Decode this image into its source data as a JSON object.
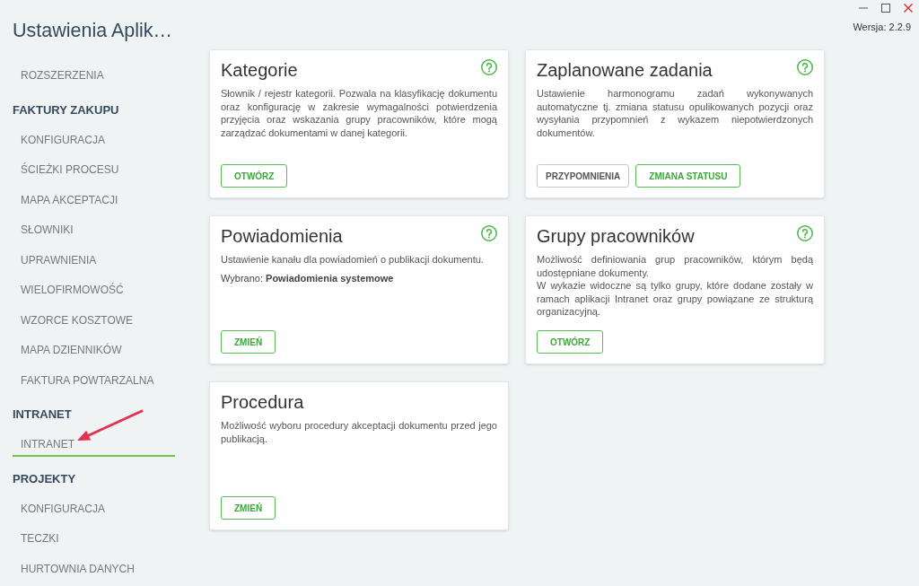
{
  "window": {
    "title": "Ustawienia Aplik…",
    "version": "Wersja: 2.2.9"
  },
  "sidebar": {
    "items": [
      {
        "label": "ROZSZERZENIA",
        "selected": false
      }
    ],
    "sections": [
      {
        "heading": "FAKTURY ZAKUPU",
        "items": [
          {
            "label": "KONFIGURACJA",
            "selected": false
          },
          {
            "label": "ŚCIEŻKI PROCESU",
            "selected": false
          },
          {
            "label": "MAPA AKCEPTACJI",
            "selected": false
          },
          {
            "label": "SŁOWNIKI",
            "selected": false
          },
          {
            "label": "UPRAWNIENIA",
            "selected": false
          },
          {
            "label": "WIELOFIRMOWOŚĆ",
            "selected": false
          },
          {
            "label": "WZORCE KOSZTOWE",
            "selected": false
          },
          {
            "label": "MAPA DZIENNIKÓW",
            "selected": false
          },
          {
            "label": "FAKTURA POWTARZALNA",
            "selected": false
          }
        ]
      },
      {
        "heading": "INTRANET",
        "items": [
          {
            "label": "INTRANET",
            "selected": true
          }
        ]
      },
      {
        "heading": "PROJEKTY",
        "items": [
          {
            "label": "KONFIGURACJA",
            "selected": false
          },
          {
            "label": "TECZKI",
            "selected": false
          },
          {
            "label": "HURTOWNIA DANYCH",
            "selected": false
          }
        ]
      }
    ]
  },
  "cards": [
    {
      "title": "Kategorie",
      "help": true,
      "description": [
        "Słownik / rejestr kategorii. Pozwala na klasyfikację dokumentu oraz konfigurację w zakresie wymagalności potwierdzenia przyjęcia oraz wskazania grupy pracowników, które mogą zarządzać dokumentami w danej kategorii."
      ],
      "buttons": [
        {
          "label": "OTWÓRZ",
          "kind": "primary"
        }
      ]
    },
    {
      "title": "Zaplanowane zadania",
      "help": true,
      "description": [
        "Ustawienie harmonogramu zadań wykonywanych automatyczne tj. zmiana statusu opulikowanych pozycji oraz wysyłania przypomnień z wykazem niepotwierdzonych dokumentów."
      ],
      "buttons": [
        {
          "label": "PRZYPOMNIENIA",
          "kind": "secondary"
        },
        {
          "label": "ZMIANA STATUSU",
          "kind": "primary"
        }
      ]
    },
    {
      "title": "Powiadomienia",
      "help": true,
      "description": [
        "Ustawienie kanału dla powiadomień o publikacji dokumentu."
      ],
      "selection": "Wybrano: **Powiadomienia systemowe**",
      "buttons": [
        {
          "label": "ZMIEŃ",
          "kind": "primary"
        }
      ]
    },
    {
      "title": "Grupy pracowników",
      "help": true,
      "description": [
        "Możliwość definiowania grup pracowników, którym będą udostępniane dokumenty.",
        "W wykazie widoczne są tylko grupy, które dodane zostały w ramach aplikacji Intranet oraz grupy powiązane ze strukturą organizacyjną."
      ],
      "buttons": [
        {
          "label": "OTWÓRZ",
          "kind": "primary"
        }
      ]
    },
    {
      "title": "Procedura",
      "help": false,
      "description": [
        "Możliwość wyboru procedury akceptacji dokumentu przed jego publikacją."
      ],
      "buttons": [
        {
          "label": "ZMIEŃ",
          "kind": "primary"
        }
      ]
    }
  ]
}
